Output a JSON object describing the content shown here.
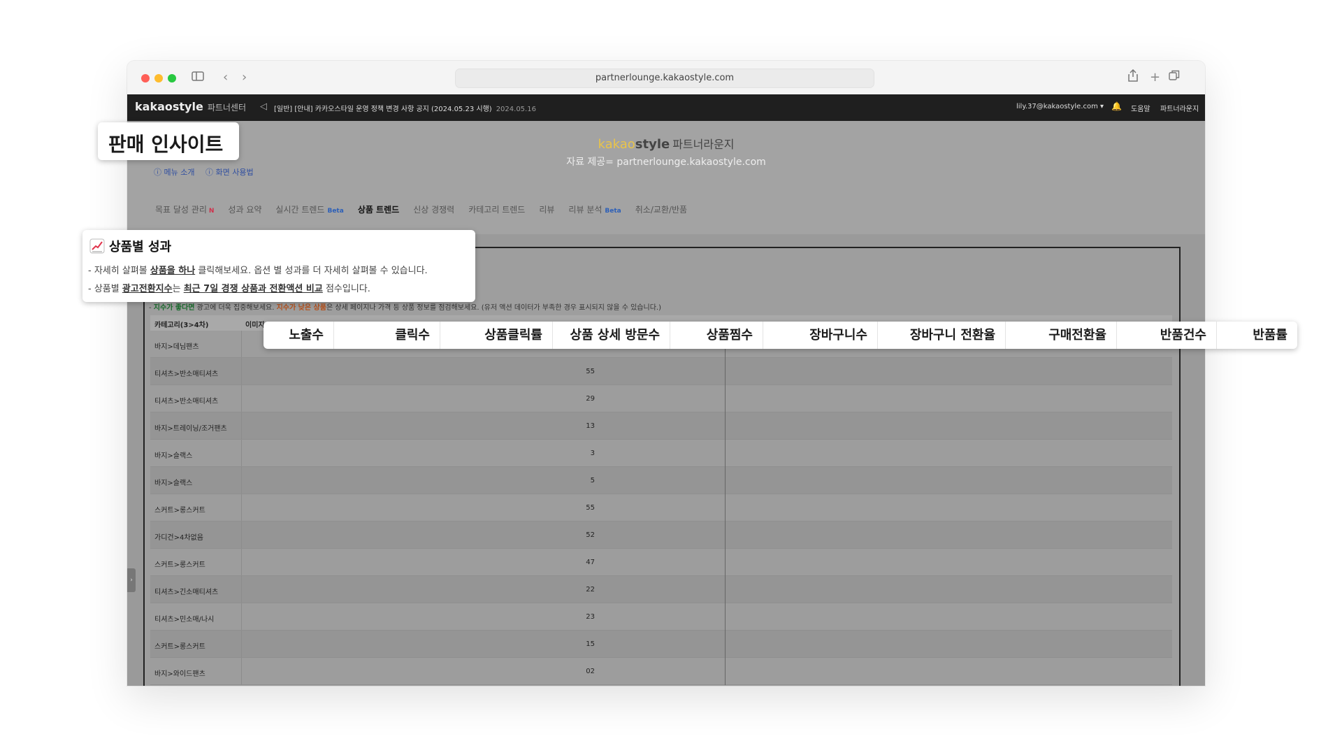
{
  "browser": {
    "url": "partnerlounge.kakaostyle.com"
  },
  "site_header": {
    "logo": "kakaostyle",
    "logo_sub": "파트너센터",
    "notice": "[일반] [안내] 카카오스타일 운영 정책 변경 사항 공지 (2024.05.23 시행)",
    "notice_date": "2024.05.16",
    "account": "lily.37@kakaostyle.com ▾",
    "help": "도움말",
    "lounge": "파트너라운지"
  },
  "watermark": {
    "kakao": "kakao",
    "style": "style",
    "lounge": "파트너라운지",
    "source": "자료 제공= partnerlounge.kakaostyle.com"
  },
  "help_links": {
    "menu_intro": "ⓘ 메뉴 소개",
    "screen_usage": "ⓘ 화면 사용법"
  },
  "nav_tabs": [
    {
      "label": "목표 달성 관리",
      "badge": "N"
    },
    {
      "label": "성과 요약",
      "badge": ""
    },
    {
      "label": "실시간 트렌드",
      "badge": "Beta"
    },
    {
      "label": "상품 트렌드",
      "badge": "",
      "active": true
    },
    {
      "label": "신상 경쟁력",
      "badge": ""
    },
    {
      "label": "카테고리 트렌드",
      "badge": ""
    },
    {
      "label": "리뷰",
      "badge": ""
    },
    {
      "label": "리뷰 분석",
      "badge": "Beta"
    },
    {
      "label": "취소/교환/반품",
      "badge": ""
    }
  ],
  "hint": {
    "prefix": "- ",
    "green": "지수가 좋다면",
    "mid": " 광고에 더욱 집중해보세요. ",
    "orange": "지수가 낮은 상품",
    "rest": "은 상세 페이지나 가격 등 상품 정보를 점검해보세요. (유저 액션 데이터가 부족한 경우 표시되지 않을 수 있습니다.)"
  },
  "table": {
    "header_category": "카테고리(3>4차)",
    "header_image": "이미지",
    "rows": [
      {
        "category": "바지>데님팬츠",
        "value": ""
      },
      {
        "category": "티셔츠>반소매티셔츠",
        "value": "55"
      },
      {
        "category": "티셔츠>반소매티셔츠",
        "value": "29"
      },
      {
        "category": "바지>트레이닝/조거팬츠",
        "value": "13"
      },
      {
        "category": "바지>슬랙스",
        "value": "3"
      },
      {
        "category": "바지>슬랙스",
        "value": "5"
      },
      {
        "category": "스커트>롱스커트",
        "value": "55"
      },
      {
        "category": "가디건>4차없음",
        "value": "52"
      },
      {
        "category": "스커트>롱스커트",
        "value": "47"
      },
      {
        "category": "티셔츠>긴소매티셔츠",
        "value": "22"
      },
      {
        "category": "티셔츠>민소매/나시",
        "value": "23"
      },
      {
        "category": "스커트>롱스커트",
        "value": "15"
      },
      {
        "category": "바지>와이드팬츠",
        "value": "02"
      }
    ]
  },
  "callouts": {
    "page_title": "판매 인사이트",
    "section_title": "상품별 성과",
    "line1_a": "- 자세히 살펴볼 ",
    "line1_u": "상품을 하나",
    "line1_b": " 클릭해보세요. 옵션 별 성과를 더 자세히 살펴볼 수 있습니다.",
    "line2_a": "- 상품별 ",
    "line2_u1": "광고전환지수",
    "line2_b": "는 ",
    "line2_u2": "최근 7일 경쟁 상품과 전환액션 비교",
    "line2_c": " 점수입니다.",
    "columns": [
      "노출수",
      "클릭수",
      "상품클릭률",
      "상품 상세 방문수",
      "상품찜수",
      "장바구니수",
      "장바구니 전환율",
      "구매전환율",
      "반품건수",
      "반품률"
    ]
  }
}
